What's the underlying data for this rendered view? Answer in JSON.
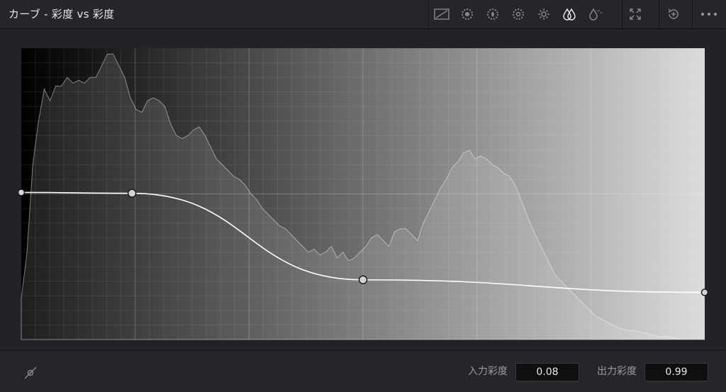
{
  "header": {
    "title": "カーブ - 彩度 vs 彩度",
    "tools": [
      {
        "name": "curve-custom-icon"
      },
      {
        "name": "hue-vs-hue-icon"
      },
      {
        "name": "hue-vs-sat-icon"
      },
      {
        "name": "hue-vs-lum-icon"
      },
      {
        "name": "lum-vs-sat-icon"
      },
      {
        "name": "sat-vs-sat-icon",
        "active": true
      },
      {
        "name": "sat-vs-lum-icon"
      }
    ],
    "expand_icon": "expand-icon",
    "reset_icon": "reset-icon",
    "more_icon": "more-options-icon"
  },
  "colors": {
    "curve": "#ffffff",
    "histogram_fill": "rgba(255,255,255,0.12)",
    "histogram_stroke": "rgba(255,255,255,0.45)",
    "grid_major": "rgba(255,255,255,0.22)",
    "grid_minor": "rgba(255,255,255,0.08)"
  },
  "curve": {
    "points": [
      {
        "x": 0.0,
        "y": 0.495
      },
      {
        "x": 0.162,
        "y": 0.498
      },
      {
        "x": 0.5,
        "y": 0.795
      },
      {
        "x": 1.0,
        "y": 0.838
      }
    ]
  },
  "histogram": [
    0.86,
    0.7,
    0.4,
    0.25,
    0.14,
    0.18,
    0.13,
    0.13,
    0.1,
    0.12,
    0.11,
    0.12,
    0.1,
    0.1,
    0.06,
    0.02,
    0.02,
    0.06,
    0.1,
    0.17,
    0.21,
    0.22,
    0.18,
    0.17,
    0.18,
    0.2,
    0.26,
    0.3,
    0.31,
    0.3,
    0.28,
    0.27,
    0.3,
    0.34,
    0.38,
    0.4,
    0.42,
    0.44,
    0.45,
    0.47,
    0.5,
    0.52,
    0.55,
    0.57,
    0.59,
    0.61,
    0.62,
    0.64,
    0.66,
    0.68,
    0.7,
    0.69,
    0.71,
    0.7,
    0.68,
    0.72,
    0.7,
    0.73,
    0.72,
    0.7,
    0.68,
    0.65,
    0.64,
    0.66,
    0.68,
    0.63,
    0.62,
    0.62,
    0.64,
    0.66,
    0.6,
    0.56,
    0.52,
    0.48,
    0.45,
    0.41,
    0.39,
    0.36,
    0.35,
    0.38,
    0.37,
    0.38,
    0.4,
    0.41,
    0.43,
    0.44,
    0.47,
    0.52,
    0.57,
    0.62,
    0.66,
    0.7,
    0.74,
    0.78,
    0.8,
    0.82,
    0.84,
    0.86,
    0.88,
    0.9,
    0.92,
    0.93,
    0.94,
    0.95,
    0.96,
    0.965,
    0.97,
    0.97,
    0.975,
    0.98,
    0.985,
    0.99,
    0.99,
    0.99,
    0.995,
    1.0,
    1.0,
    1.0,
    1.0,
    1.0
  ],
  "footer": {
    "picker_icon": "eyedropper-icon",
    "input_label": "入力彩度",
    "input_value": "0.08",
    "output_label": "出力彩度",
    "output_value": "0.99"
  }
}
